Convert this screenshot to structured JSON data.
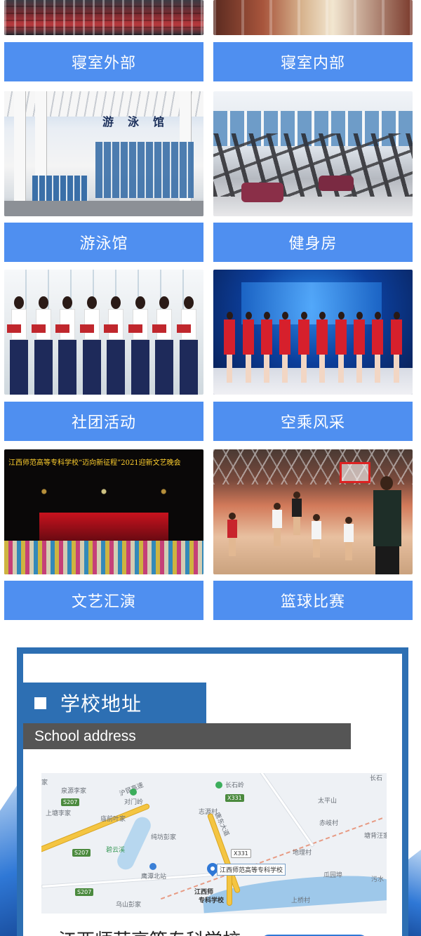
{
  "gallery": {
    "items": [
      {
        "label": "寝室外部"
      },
      {
        "label": "寝室内部"
      },
      {
        "label": "游泳馆"
      },
      {
        "label": "健身房"
      },
      {
        "label": "社团活动"
      },
      {
        "label": "空乘风采"
      },
      {
        "label": "文艺汇演"
      },
      {
        "label": "篮球比赛"
      }
    ],
    "photo_text": {
      "pool_sign": "游泳馆",
      "art_banner": "江西师范高等专科学校“迈向新征程”2021迎新文艺晚会"
    }
  },
  "address": {
    "title": "学校地址",
    "subtitle": "School address",
    "map": {
      "labels": {
        "quanyuan": "泉源李家",
        "s207a": "S207",
        "s207b": "S207",
        "s207c": "S207",
        "shangtang": "上塘李家",
        "duimenling": "对门岭",
        "miaoqian": "庙前叶家",
        "chunfang": "纯坊彭家",
        "biyunxi": "碧云溪",
        "hubaobei": "鹰潭北站",
        "wushan": "乌山彭家",
        "changshiling": "长石岭",
        "x331a": "X331",
        "x331b": "X331",
        "zhiyuan": "志源村",
        "taiping": "太平山",
        "chiqi": "赤岐村",
        "tangbei": "塘背汪家",
        "dili": "地理村",
        "guayuan": "瓜园埠",
        "shangqiao": "上桥村",
        "wushui": "污水",
        "changshi2": "长石",
        "huhai": "沪昆高速",
        "tangdong": "唐东大道",
        "jia": "家",
        "zhuanke": "专科学校",
        "jiangxi_short": "江西师"
      },
      "pin_callout": "江西师范高等专科学校"
    },
    "school_name": "江西师范高等专科学校"
  }
}
